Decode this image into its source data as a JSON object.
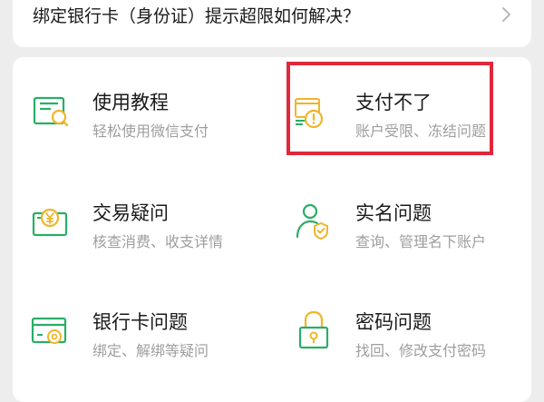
{
  "faq": {
    "question": "绑定银行卡（身份证）提示超限如何解决？"
  },
  "items": [
    {
      "id": "tutorial",
      "icon": "tutorial-book-icon",
      "title": "使用教程",
      "subtitle": "轻松使用微信支付"
    },
    {
      "id": "cannot-pay",
      "icon": "card-warning-icon",
      "title": "支付不了",
      "subtitle": "账户受限、冻结问题"
    },
    {
      "id": "transaction",
      "icon": "yuan-bill-icon",
      "title": "交易疑问",
      "subtitle": "核查消费、收支详情"
    },
    {
      "id": "realname",
      "icon": "user-shield-icon",
      "title": "实名问题",
      "subtitle": "查询、管理名下账户"
    },
    {
      "id": "bankcard",
      "icon": "bank-card-icon",
      "title": "银行卡问题",
      "subtitle": "绑定、解绑等疑问"
    },
    {
      "id": "password",
      "icon": "lock-icon",
      "title": "密码问题",
      "subtitle": "找回、修改支付密码"
    }
  ],
  "colors": {
    "icon_green": "#2aae67",
    "icon_gold": "#f0b52a",
    "highlight": "#e0273b"
  }
}
